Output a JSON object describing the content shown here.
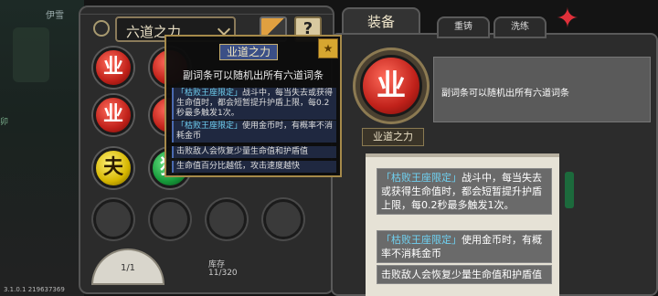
{
  "left_panel": {
    "title": "六道之力",
    "help_label": "?",
    "orbs": [
      {
        "glyph": "业",
        "color": "red"
      },
      {
        "glyph": "业",
        "color": "red"
      },
      {
        "glyph": "夫",
        "color": "yellow"
      },
      {
        "glyph": "猫",
        "color": "green"
      }
    ],
    "fan_text": "1/1",
    "stock_label": "库存",
    "stock_value": "11/320"
  },
  "background": {
    "hud_text": "伊雪",
    "side_text": "卯",
    "version": "3.1.0.1 219637369"
  },
  "right_panel": {
    "tabs": [
      "装备",
      "重铸",
      "洗练"
    ],
    "orb_glyph": "业",
    "orb_name": "业道之力",
    "description": "副词条可以随机出所有六道词条",
    "entries": [
      {
        "tag": "「枯败王座限定」",
        "text": "战斗中，每当失去或获得生命值时，都会短暂提升护盾上限，每0.2秒最多触发1次。"
      },
      {
        "tag": "「枯败王座限定」",
        "text": "使用金币时，有概率不消耗金币"
      },
      {
        "tag": "",
        "text": "击败敌人会恢复少量生命值和护盾值"
      }
    ]
  },
  "tooltip": {
    "title": "业道之力",
    "lock_icon": "★",
    "description": "副词条可以随机出所有六道词条",
    "lines": [
      {
        "tag": "「枯败王座限定」",
        "text": "战斗中，每当失去或获得生命值时，都会短暂提升护盾上限，每0.2秒最多触发1次。"
      },
      {
        "tag": "「枯败王座限定」",
        "text": "使用金币时，有概率不消耗金币"
      },
      {
        "tag": "",
        "text": "击败敌人会恢复少量生命值和护盾值"
      },
      {
        "tag": "",
        "text": "生命值百分比越低，攻击速度越快"
      }
    ]
  },
  "colors": {
    "accent": "#a68a4a",
    "tag": "#6fd0f0",
    "red_orb": "#c0211a"
  }
}
